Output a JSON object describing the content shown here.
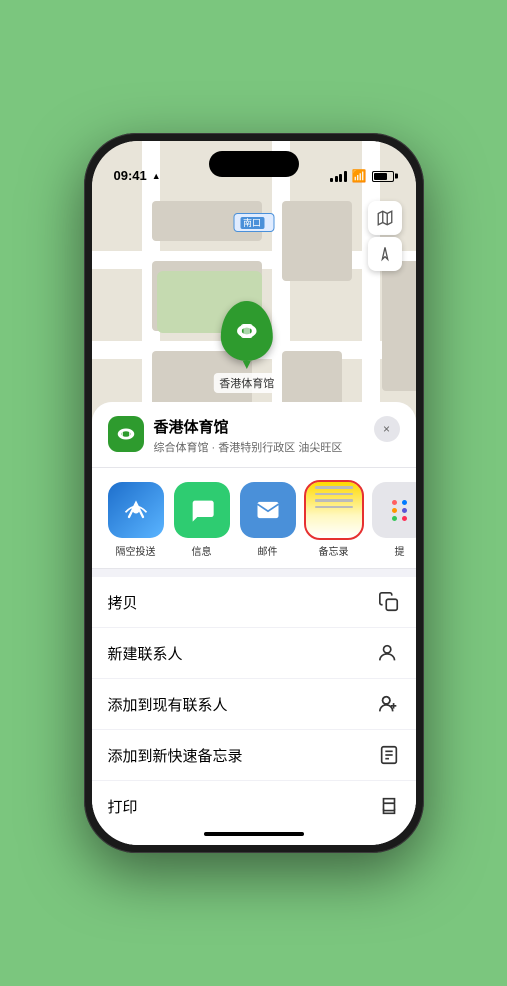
{
  "phone": {
    "status_bar": {
      "time": "09:41",
      "location_arrow": "▲"
    },
    "map": {
      "gate_label": "南口",
      "stadium_label": "香港体育馆",
      "map_btn_map": "🗺",
      "map_btn_location": "➤"
    },
    "location_card": {
      "name": "香港体育馆",
      "description": "综合体育馆 · 香港特别行政区 油尖旺区",
      "close_label": "×"
    },
    "share_actions": [
      {
        "id": "airdrop",
        "label": "隔空投送",
        "type": "airdrop"
      },
      {
        "id": "messages",
        "label": "信息",
        "type": "message"
      },
      {
        "id": "mail",
        "label": "邮件",
        "type": "mail"
      },
      {
        "id": "notes",
        "label": "备忘录",
        "type": "notes",
        "selected": true
      },
      {
        "id": "more",
        "label": "提",
        "type": "more"
      }
    ],
    "action_items": [
      {
        "id": "copy",
        "label": "拷贝",
        "icon": "copy"
      },
      {
        "id": "new-contact",
        "label": "新建联系人",
        "icon": "person-add"
      },
      {
        "id": "add-existing",
        "label": "添加到现有联系人",
        "icon": "person-plus"
      },
      {
        "id": "add-quick-note",
        "label": "添加到新快速备忘录",
        "icon": "note"
      }
    ],
    "partial_item": {
      "label": "打印",
      "icon": "printer"
    }
  }
}
